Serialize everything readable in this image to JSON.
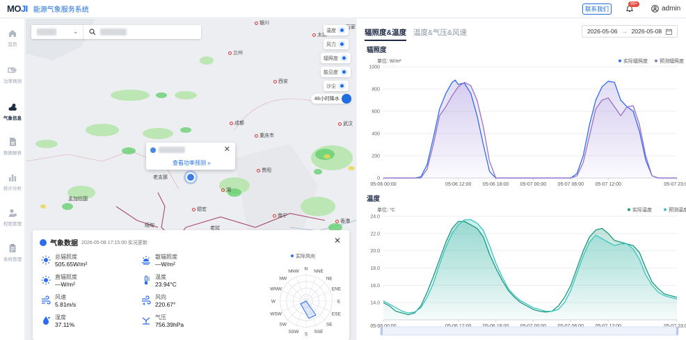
{
  "header": {
    "logo_main": "MO",
    "logo_accent": "JI",
    "app_name": "能源气象服务系统",
    "contact_label": "联系我们",
    "notification_count": "99+",
    "user_name": "admin"
  },
  "sidebar": {
    "items": [
      {
        "label": "首页",
        "icon": "home-icon",
        "active": false
      },
      {
        "label": "功率预测",
        "icon": "power-forecast-icon",
        "active": false
      },
      {
        "label": "气象信息",
        "icon": "weather-icon",
        "active": true
      },
      {
        "label": "数据报表",
        "icon": "report-icon",
        "active": false
      },
      {
        "label": "统计分析",
        "icon": "bar-chart-icon",
        "active": false
      },
      {
        "label": "权限管理",
        "icon": "user-permission-icon",
        "active": false
      },
      {
        "label": "系统管理",
        "icon": "clipboard-icon",
        "active": false
      }
    ]
  },
  "map": {
    "layer_controls": [
      {
        "label": "温度",
        "icon": "temperature-icon"
      },
      {
        "label": "风力",
        "icon": "wind-icon"
      },
      {
        "label": "辐照度",
        "icon": "irradiance-icon"
      },
      {
        "label": "能见度",
        "icon": "visibility-icon"
      },
      {
        "label": "沙尘",
        "icon": "dust-icon"
      }
    ],
    "rain_control": "48小时降水",
    "cities": [
      "银川",
      "太原",
      "石家",
      "兰州",
      "西安",
      "成都",
      "重庆市",
      "武汉",
      "贵阳",
      "南宁",
      "香港",
      "老挝",
      "孟加拉国",
      "缅甸",
      "德宏",
      "班",
      "湖",
      "老支那"
    ],
    "popup": {
      "link": "查看功率预测 »"
    }
  },
  "weather_panel": {
    "title": "气象数据",
    "updated": "2026-05-08 17:15:00 实况更新",
    "items": [
      {
        "label": "总辐照度",
        "value": "505.65W/m²",
        "icon": "sun-icon"
      },
      {
        "label": "散辐照度",
        "value": "—W/m²",
        "icon": "diffuse-sun-icon"
      },
      {
        "label": "直辐照度",
        "value": "—W/m²",
        "icon": "direct-sun-icon"
      },
      {
        "label": "温度",
        "value": "23.94°C",
        "icon": "thermometer-icon"
      },
      {
        "label": "风速",
        "value": "5.81m/s",
        "icon": "wind-speed-icon"
      },
      {
        "label": "风向",
        "value": "220.67°",
        "icon": "wind-direction-icon"
      },
      {
        "label": "湿度",
        "value": "37.11%",
        "icon": "humidity-icon"
      },
      {
        "label": "气压",
        "value": "756.39hPa",
        "icon": "pressure-icon"
      }
    ],
    "rose_legend": "实际风向",
    "directions": [
      "N",
      "NNW",
      "NW",
      "WNW",
      "W",
      "WSW",
      "SW",
      "SSW",
      "S",
      "SSE",
      "SE",
      "ESE",
      "E",
      "ENE",
      "NE",
      "NNE"
    ]
  },
  "right_panel": {
    "tabs": [
      "辐照度&温度",
      "温度&气压&风速"
    ],
    "date_start": "2026-05-06",
    "date_sep": "→",
    "date_end": "2026-05-08",
    "section1": "辐照度",
    "section2": "温度"
  },
  "chart_data": [
    {
      "type": "line",
      "unit_label": "单位: W/m²",
      "ylim": [
        0,
        1000
      ],
      "yticks": [
        "0",
        "200",
        "400",
        "600",
        "800",
        "1000"
      ],
      "xticks": [
        "05-06 00:00",
        "05-06 12:00",
        "05-06 18:00",
        "05-07 00:00",
        "05-07 06:00",
        "05-07 12:00",
        "05-07 23:00"
      ],
      "xtick_hours": [
        0,
        12,
        18,
        24,
        30,
        36,
        47
      ],
      "legend": [
        "实际辐照度",
        "预测辐照度"
      ],
      "colors": [
        "#2c6cf0",
        "#9a6fc8"
      ],
      "series": [
        {
          "name": "实际辐照度",
          "x": [
            0,
            2,
            4,
            5,
            6,
            7,
            8,
            9,
            10,
            11,
            11.5,
            12,
            12.5,
            13,
            14,
            15,
            16,
            17,
            18,
            19,
            20,
            22,
            24,
            26,
            28,
            29,
            30,
            31,
            32,
            33,
            34,
            35,
            36,
            37,
            38,
            39,
            40,
            41,
            42,
            43,
            44,
            46,
            47
          ],
          "y": [
            0,
            0,
            0,
            0,
            10,
            120,
            360,
            620,
            760,
            860,
            880,
            840,
            850,
            850,
            760,
            560,
            300,
            60,
            0,
            0,
            0,
            0,
            0,
            0,
            0,
            0,
            0,
            40,
            200,
            480,
            700,
            820,
            870,
            860,
            700,
            640,
            600,
            420,
            160,
            20,
            0,
            0,
            0
          ]
        },
        {
          "name": "预测辐照度",
          "x": [
            0,
            2,
            4,
            5,
            6,
            7,
            8,
            9,
            10,
            11,
            12,
            13,
            14,
            15,
            16,
            17,
            18,
            19,
            20,
            22,
            24,
            26,
            28,
            29,
            30,
            31,
            32,
            33,
            34,
            35,
            36,
            37,
            38,
            39,
            40,
            41,
            42,
            43,
            44,
            46,
            47
          ],
          "y": [
            0,
            0,
            0,
            0,
            0,
            80,
            300,
            560,
            640,
            740,
            820,
            860,
            830,
            700,
            460,
            150,
            0,
            0,
            0,
            0,
            0,
            0,
            0,
            0,
            0,
            20,
            140,
            380,
            620,
            700,
            720,
            640,
            560,
            640,
            650,
            480,
            200,
            20,
            0,
            0,
            0
          ]
        }
      ]
    },
    {
      "type": "line",
      "unit_label": "单位: °C",
      "ylim": [
        12,
        24
      ],
      "yticks": [
        "14.0",
        "16.0",
        "18.0",
        "20.0",
        "22.0",
        "24.0"
      ],
      "xticks": [
        "05-06 00:00",
        "05-06 12:00",
        "05-06 18:00",
        "05-07 00:00",
        "05-07 06:00",
        "05-07 12:00",
        "05-07 23:00"
      ],
      "xtick_hours": [
        0,
        12,
        18,
        24,
        30,
        36,
        47
      ],
      "legend": [
        "实际温度",
        "预测温度"
      ],
      "colors": [
        "#1a9a7a",
        "#3cc3c0"
      ],
      "series": [
        {
          "name": "实际温度",
          "x": [
            0,
            1,
            2,
            3,
            4,
            5,
            6,
            7,
            8,
            9,
            10,
            11,
            12,
            13,
            14,
            15,
            16,
            17,
            18,
            19,
            20,
            21,
            22,
            23,
            24,
            25,
            26,
            27,
            28,
            29,
            30,
            31,
            32,
            33,
            34,
            35,
            36,
            37,
            38,
            39,
            40,
            41,
            42,
            43,
            44,
            45,
            46,
            47
          ],
          "y": [
            14.0,
            13.6,
            13.0,
            12.8,
            12.6,
            12.8,
            13.6,
            15.2,
            17.0,
            19.0,
            21.0,
            22.6,
            23.4,
            23.4,
            23.0,
            22.6,
            21.6,
            19.6,
            18.0,
            16.6,
            15.4,
            14.6,
            14.0,
            13.6,
            13.2,
            13.0,
            12.9,
            13.0,
            13.6,
            14.6,
            16.0,
            18.0,
            20.0,
            21.6,
            22.4,
            22.6,
            22.0,
            21.2,
            21.0,
            20.8,
            20.6,
            19.8,
            18.0,
            16.4,
            15.6,
            15.0,
            14.8,
            14.6
          ]
        },
        {
          "name": "预测温度",
          "x": [
            0,
            1,
            2,
            3,
            4,
            5,
            6,
            7,
            8,
            9,
            10,
            11,
            12,
            13,
            14,
            15,
            16,
            17,
            18,
            19,
            20,
            21,
            22,
            23,
            24,
            25,
            26,
            27,
            28,
            29,
            30,
            31,
            32,
            33,
            34,
            35,
            36,
            37,
            38,
            39,
            40,
            41,
            42,
            43,
            44,
            45,
            46,
            47
          ],
          "y": [
            14.2,
            13.8,
            13.4,
            13.0,
            12.8,
            12.9,
            13.4,
            14.6,
            16.2,
            18.4,
            20.4,
            22.0,
            23.0,
            23.6,
            23.6,
            23.2,
            22.4,
            20.6,
            18.6,
            17.0,
            15.6,
            14.8,
            14.2,
            13.8,
            13.4,
            13.2,
            13.0,
            13.0,
            13.2,
            14.0,
            15.4,
            17.4,
            19.4,
            21.0,
            21.8,
            21.4,
            21.0,
            20.6,
            20.8,
            20.8,
            20.2,
            19.0,
            17.2,
            16.0,
            15.2,
            14.8,
            14.6,
            14.4
          ]
        }
      ]
    }
  ]
}
